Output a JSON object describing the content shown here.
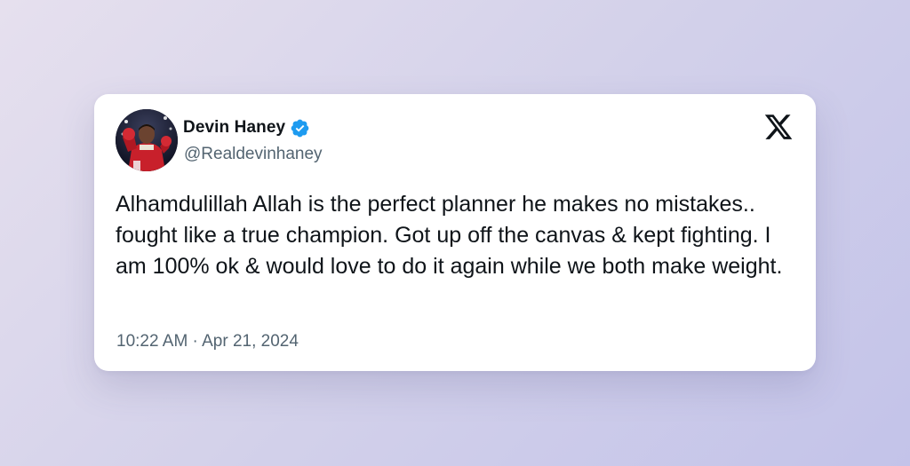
{
  "tweet": {
    "author": {
      "display_name": "Devin Haney",
      "handle": "@Realdevinhaney",
      "verified": true,
      "avatar_icon": "boxer-avatar"
    },
    "text": "Alhamdulillah Allah is the perfect planner he makes no mistakes.. fought like a true champion. Got up off the canvas & kept fighting. I am 100% ok & would love to do it again while we both make weight.",
    "timestamp": "10:22 AM · Apr 21, 2024",
    "brand_icon": "x-logo-icon"
  },
  "colors": {
    "background_start": "#e6e0ee",
    "background_end": "#c3c3e9",
    "card": "#ffffff",
    "text_primary": "#0f1419",
    "text_secondary": "#536471",
    "verified_blue": "#1d9bf0"
  }
}
